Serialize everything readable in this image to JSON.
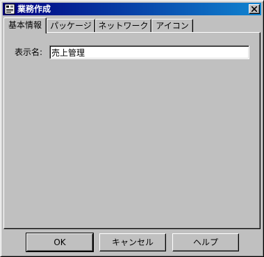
{
  "window": {
    "title": "業務作成",
    "close_icon": "close-icon",
    "app_icon": "business-app-icon"
  },
  "tabs": [
    {
      "label": "基本情報",
      "active": true
    },
    {
      "label": "パッケージ",
      "active": false
    },
    {
      "label": "ネットワーク",
      "active": false
    },
    {
      "label": "アイコン",
      "active": false
    }
  ],
  "form": {
    "display_name_label": "表示名:",
    "display_name_value": "売上管理"
  },
  "buttons": {
    "ok": "OK",
    "cancel": "キャンセル",
    "help": "ヘルプ"
  },
  "colors": {
    "titlebar_start": "#000080",
    "titlebar_end": "#1084d0",
    "face": "#c0c0c0"
  }
}
